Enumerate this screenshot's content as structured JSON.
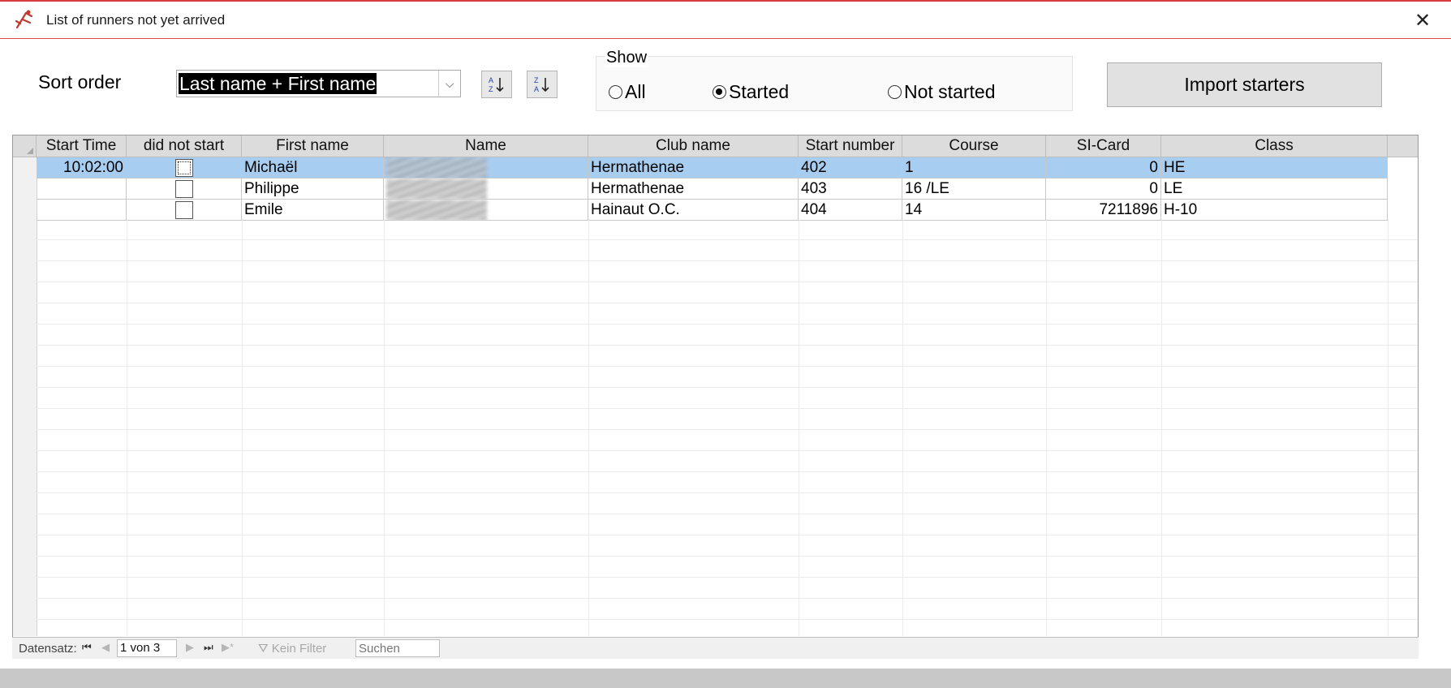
{
  "window": {
    "title": "List of runners not yet arrived",
    "close_icon": "close-icon"
  },
  "toolbar": {
    "sort_label": "Sort order",
    "sort_value": "Last name + First name",
    "sort_asc_icon": "sort-ascending-icon",
    "sort_desc_icon": "sort-descending-icon",
    "show_group_title": "Show",
    "radio_all": "All",
    "radio_started": "Started",
    "radio_not_started": "Not started",
    "selected_filter": "Started",
    "import_label": "Import starters"
  },
  "grid": {
    "columns": [
      "Start Time",
      "did not start",
      "First name",
      "Name",
      "Club name",
      "Start number",
      "Course",
      "SI-Card",
      "Class"
    ],
    "rows": [
      {
        "start_time": "10:02:00",
        "dns": false,
        "first_name": "Michaël",
        "name": "",
        "club": "Hermathenae",
        "start_number": "402",
        "course": "1",
        "si_card": "0",
        "class": "HE",
        "selected": true
      },
      {
        "start_time": "",
        "dns": false,
        "first_name": "Philippe",
        "name": "",
        "club": "Hermathenae",
        "start_number": "403",
        "course": "16 /LE",
        "si_card": "0",
        "class": "LE",
        "selected": false
      },
      {
        "start_time": "",
        "dns": false,
        "first_name": "Emile",
        "name": "",
        "club": "Hainaut O.C.",
        "start_number": "404",
        "course": "14",
        "si_card": "7211896",
        "class": "H-10",
        "selected": false
      }
    ]
  },
  "navigation": {
    "record_label": "Datensatz:",
    "record_position": "1 von 3",
    "filter_label": "Kein Filter",
    "search_placeholder": "Suchen"
  }
}
